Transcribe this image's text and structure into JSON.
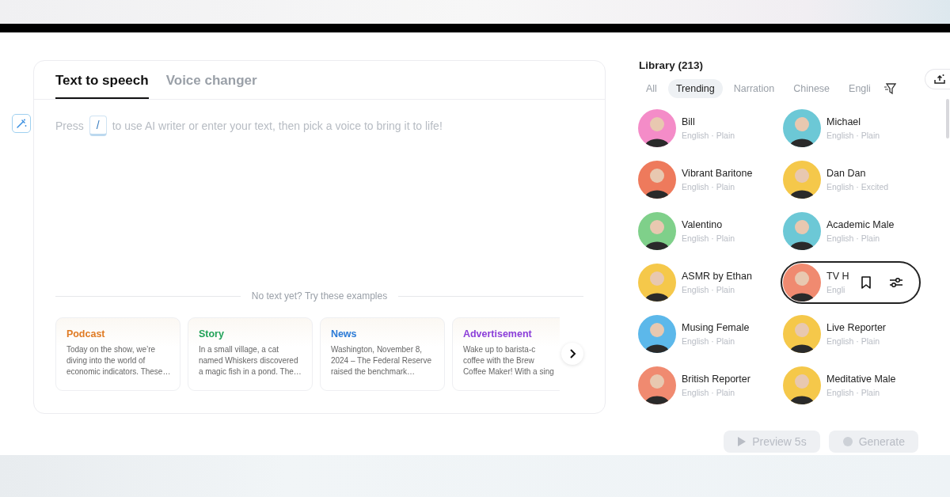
{
  "editor": {
    "tabs": [
      {
        "label": "Text to speech",
        "selected": true
      },
      {
        "label": "Voice changer",
        "selected": false
      }
    ],
    "prompt": {
      "before": "Press",
      "key": "/",
      "after": "to use AI writer or enter your text, then pick a voice to bring it to life!"
    },
    "examples_heading": "No text yet? Try these examples",
    "examples": [
      {
        "title": "Podcast",
        "color": "#e07b24",
        "lines": [
          "Today on the show, we’re",
          "diving into the world of",
          "economic indicators. These…"
        ]
      },
      {
        "title": "Story",
        "color": "#22a35a",
        "lines": [
          "In a small village, a cat",
          "named Whiskers discovered",
          "a magic fish in a pond. The…"
        ]
      },
      {
        "title": "News",
        "color": "#2b7bd6",
        "lines": [
          "Washington, November 8,",
          "2024 – The Federal Reserve",
          "raised the benchmark…"
        ]
      },
      {
        "title": "Advertisement",
        "color": "#8b3fd9",
        "lines": [
          "Wake up to barista-c",
          "coffee with the Brew",
          "Coffee Maker! With a sing"
        ]
      }
    ]
  },
  "library": {
    "title": "Library (213)",
    "filters": [
      {
        "label": "All",
        "selected": false
      },
      {
        "label": "Trending",
        "selected": true
      },
      {
        "label": "Narration",
        "selected": false
      },
      {
        "label": "Chinese",
        "selected": false
      },
      {
        "label": "Engli",
        "selected": false
      }
    ],
    "voices": [
      {
        "name": "Bill",
        "meta": "English · Plain",
        "color": "#f48cc8",
        "hovered": false
      },
      {
        "name": "Michael",
        "meta": "English · Plain",
        "color": "#6cc8d6",
        "hovered": false
      },
      {
        "name": "Vibrant Baritone",
        "meta": "English · Plain",
        "color": "#ee7a5c",
        "hovered": false
      },
      {
        "name": "Dan Dan",
        "meta": "English · Excited",
        "color": "#f5c84a",
        "hovered": false
      },
      {
        "name": "Valentino",
        "meta": "English · Plain",
        "color": "#7fd08a",
        "hovered": false
      },
      {
        "name": "Academic Male",
        "meta": "English · Plain",
        "color": "#6cc8d6",
        "hovered": false
      },
      {
        "name": "ASMR by Ethan",
        "meta": "English · Plain",
        "color": "#f5c84a",
        "hovered": false
      },
      {
        "name": "TV H",
        "meta": "Engli",
        "color": "#f08a70",
        "hovered": true
      },
      {
        "name": "Musing Female",
        "meta": "English · Plain",
        "color": "#5cb8ea",
        "hovered": false
      },
      {
        "name": "Live Reporter",
        "meta": "English · Plain",
        "color": "#f5c84a",
        "hovered": false
      },
      {
        "name": "British Reporter",
        "meta": "English · Plain",
        "color": "#f08a70",
        "hovered": false
      },
      {
        "name": "Meditative Male",
        "meta": "English · Plain",
        "color": "#f5c84a",
        "hovered": false
      }
    ]
  },
  "actions": [
    {
      "label": "Preview 5s",
      "kind": "preview",
      "disabled": true
    },
    {
      "label": "Generate",
      "kind": "generate",
      "disabled": true
    }
  ]
}
